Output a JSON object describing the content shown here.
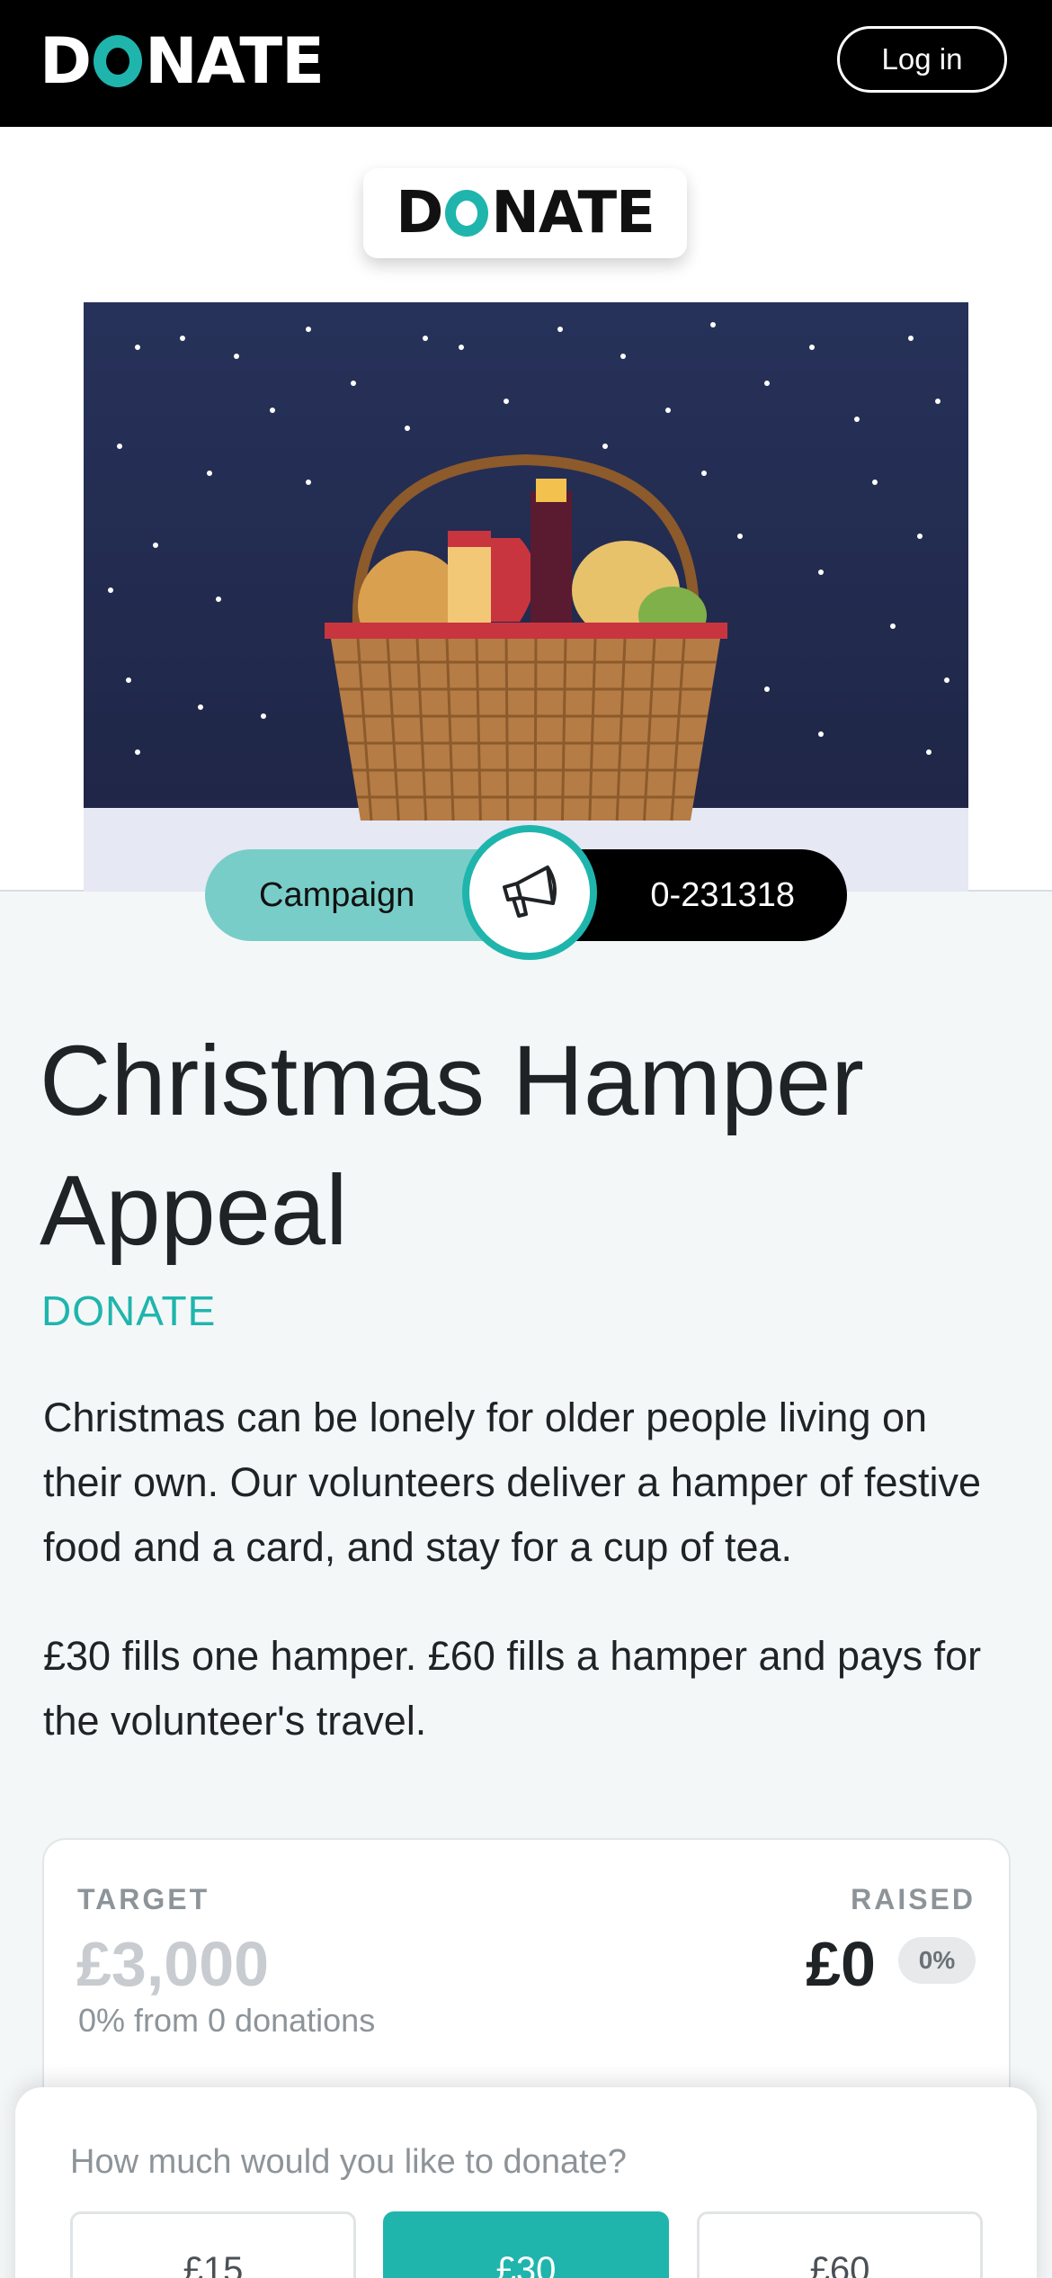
{
  "header": {
    "brand_left": "D",
    "brand_right": "NATE",
    "login_label": "Log in"
  },
  "logo_card": {
    "left": "D",
    "right": "NATE"
  },
  "campaign_pill": {
    "label": "Campaign",
    "id": "0-231318",
    "icon": "megaphone-icon"
  },
  "appeal": {
    "title": "Christmas Hamper Appeal",
    "organisation": "DONATE",
    "description_1": "Christmas can be lonely for older people living on their own. Our volunteers deliver a hamper of festive food and a card, and stay for a cup of tea.",
    "description_2": "£30 fills one hamper. £60 fills a hamper and pays for the volunteer's travel."
  },
  "stats": {
    "target_label": "TARGET",
    "target_value": "£3,000",
    "progress_text": "0% from 0 donations",
    "raised_label": "RAISED",
    "raised_value": "£0",
    "raised_percent": "0%"
  },
  "donate": {
    "question": "How much would you like to donate?",
    "amounts": [
      "£15",
      "£30",
      "£60"
    ],
    "selected": "£30"
  },
  "colors": {
    "accent": "#1fb5ad",
    "campaign_pill": "#79cdc8",
    "hero_sky": "#252f55"
  }
}
